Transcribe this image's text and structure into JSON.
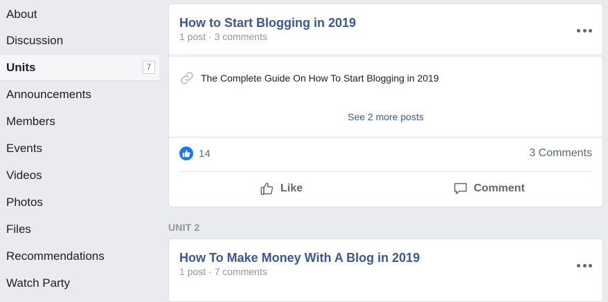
{
  "sidebar": {
    "items": [
      {
        "label": "About"
      },
      {
        "label": "Discussion"
      },
      {
        "label": "Units",
        "badge": "7",
        "active": true
      },
      {
        "label": "Announcements"
      },
      {
        "label": "Members"
      },
      {
        "label": "Events"
      },
      {
        "label": "Videos"
      },
      {
        "label": "Photos"
      },
      {
        "label": "Files"
      },
      {
        "label": "Recommendations"
      },
      {
        "label": "Watch Party"
      }
    ]
  },
  "units": [
    {
      "title": "How to Start Blogging in 2019",
      "meta": "1 post · 3 comments",
      "post_text": "The Complete Guide On How To Start Blogging in 2019",
      "see_more": "See 2 more posts",
      "like_count": "14",
      "comments_label": "3 Comments",
      "like_label": "Like",
      "comment_label": "Comment"
    },
    {
      "section_label": "UNIT 2",
      "title": "How To Make Money With A Blog in 2019",
      "meta": "1 post · 7 comments"
    }
  ],
  "colors": {
    "background": "#e9ebee",
    "link_blue": "#385898",
    "like_blue": "#1877f2",
    "muted_text": "#90949c"
  },
  "icons": [
    "link-icon",
    "like-reaction-icon",
    "thumbs-up-icon",
    "comment-bubble-icon",
    "more-options-icon"
  ]
}
